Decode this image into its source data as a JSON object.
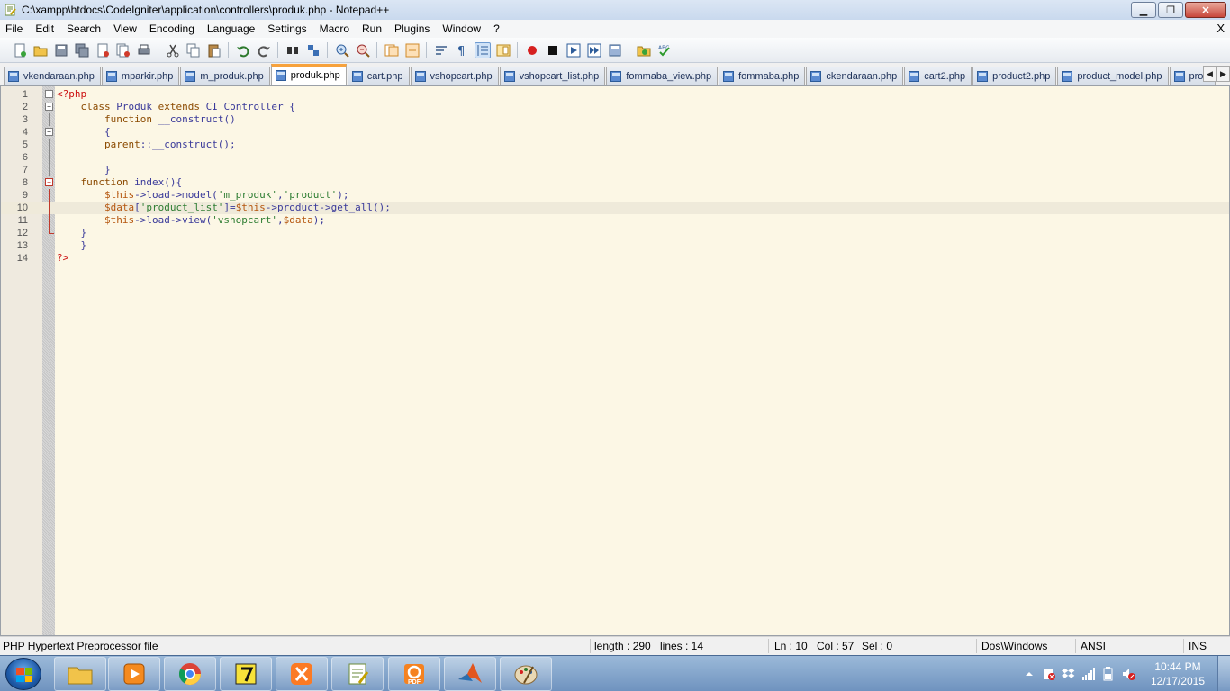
{
  "window": {
    "title": "C:\\xampp\\htdocs\\CodeIgniter\\application\\controllers\\produk.php - Notepad++",
    "minimize_glyph": "▁",
    "maximize_glyph": "❐",
    "close_glyph": "✕"
  },
  "menu": {
    "items": [
      "File",
      "Edit",
      "Search",
      "View",
      "Encoding",
      "Language",
      "Settings",
      "Macro",
      "Run",
      "Plugins",
      "Window",
      "?"
    ],
    "close_label": "X"
  },
  "tabs": [
    {
      "label": "vkendaraan.php",
      "active": false
    },
    {
      "label": "mparkir.php",
      "active": false
    },
    {
      "label": "m_produk.php",
      "active": false
    },
    {
      "label": "produk.php",
      "active": true
    },
    {
      "label": "cart.php",
      "active": false
    },
    {
      "label": "vshopcart.php",
      "active": false
    },
    {
      "label": "vshopcart_list.php",
      "active": false
    },
    {
      "label": "fommaba_view.php",
      "active": false
    },
    {
      "label": "fommaba.php",
      "active": false
    },
    {
      "label": "ckendaraan.php",
      "active": false
    },
    {
      "label": "cart2.php",
      "active": false
    },
    {
      "label": "product2.php",
      "active": false
    },
    {
      "label": "product_model.php",
      "active": false
    },
    {
      "label": "prod",
      "active": false
    }
  ],
  "tab_scroll": {
    "left": "◀",
    "right": "▶"
  },
  "editor": {
    "current_line": 10,
    "lines": [
      {
        "n": "1",
        "parts": [
          {
            "t": "<?php",
            "c": "tag"
          }
        ]
      },
      {
        "n": "2",
        "parts": [
          {
            "t": "    class ",
            "c": "kw"
          },
          {
            "t": "Produk ",
            "c": "fn"
          },
          {
            "t": "extends ",
            "c": "kw"
          },
          {
            "t": "CI_Controller {",
            "c": "fn"
          }
        ]
      },
      {
        "n": "3",
        "parts": [
          {
            "t": "        function ",
            "c": "kw"
          },
          {
            "t": "__construct()",
            "c": "fn"
          }
        ]
      },
      {
        "n": "4",
        "parts": [
          {
            "t": "        {",
            "c": "fn"
          }
        ]
      },
      {
        "n": "5",
        "parts": [
          {
            "t": "        parent",
            "c": "kw"
          },
          {
            "t": "::__construct();",
            "c": "fn"
          }
        ]
      },
      {
        "n": "6",
        "parts": [
          {
            "t": "",
            "c": "fn"
          }
        ]
      },
      {
        "n": "7",
        "parts": [
          {
            "t": "        }",
            "c": "fn"
          }
        ]
      },
      {
        "n": "8",
        "parts": [
          {
            "t": "    function ",
            "c": "kw"
          },
          {
            "t": "index(){",
            "c": "fn"
          }
        ]
      },
      {
        "n": "9",
        "parts": [
          {
            "t": "        $this",
            "c": "var"
          },
          {
            "t": "->load->model(",
            "c": "fn"
          },
          {
            "t": "'m_produk'",
            "c": "str"
          },
          {
            "t": ",",
            "c": "fn"
          },
          {
            "t": "'product'",
            "c": "str"
          },
          {
            "t": ");",
            "c": "fn"
          }
        ]
      },
      {
        "n": "10",
        "parts": [
          {
            "t": "        $data",
            "c": "var"
          },
          {
            "t": "[",
            "c": "fn"
          },
          {
            "t": "'product_list'",
            "c": "str"
          },
          {
            "t": "]=",
            "c": "fn"
          },
          {
            "t": "$this",
            "c": "var"
          },
          {
            "t": "->product->get_all();",
            "c": "fn"
          }
        ]
      },
      {
        "n": "11",
        "parts": [
          {
            "t": "        $this",
            "c": "var"
          },
          {
            "t": "->load->view(",
            "c": "fn"
          },
          {
            "t": "'vshopcart'",
            "c": "str"
          },
          {
            "t": ",",
            "c": "fn"
          },
          {
            "t": "$data",
            "c": "var"
          },
          {
            "t": ");",
            "c": "fn"
          }
        ]
      },
      {
        "n": "12",
        "parts": [
          {
            "t": "    }",
            "c": "fn"
          }
        ]
      },
      {
        "n": "13",
        "parts": [
          {
            "t": "    }",
            "c": "fn"
          }
        ]
      },
      {
        "n": "14",
        "parts": [
          {
            "t": "?>",
            "c": "tag"
          }
        ]
      }
    ]
  },
  "status": {
    "file_type": "PHP Hypertext Preprocessor file",
    "length": "length : 290",
    "lines": "lines : 14",
    "ln": "Ln : 10",
    "col": "Col : 57",
    "sel": "Sel : 0",
    "eol": "Dos\\Windows",
    "encoding": "ANSI",
    "mode": "INS"
  },
  "taskbar": {
    "apps": [
      "windows-explorer",
      "media-player",
      "chrome",
      "unknown-7",
      "xampp",
      "notepad-plus-plus",
      "foxit-pdf",
      "matlab",
      "paint"
    ],
    "pdf_label": "PDF",
    "time": "10:44 PM",
    "date": "12/17/2015",
    "colors": {
      "accent": "#f7a23c",
      "editor_bg": "#fcf7e5"
    }
  }
}
